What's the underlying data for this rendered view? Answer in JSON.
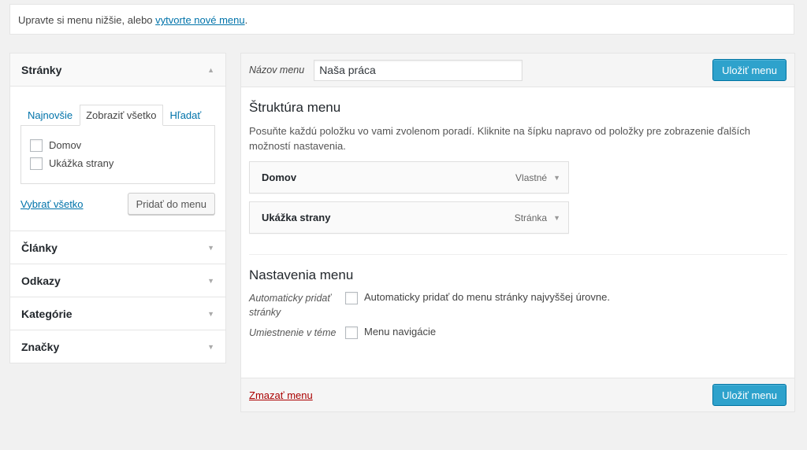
{
  "notice": {
    "text": "Upravte si menu nižšie, alebo ",
    "link": "vytvorte nové menu",
    "suffix": "."
  },
  "accordion": {
    "sections": [
      {
        "title": "Stránky",
        "open": true
      },
      {
        "title": "Články"
      },
      {
        "title": "Odkazy"
      },
      {
        "title": "Kategórie"
      },
      {
        "title": "Značky"
      }
    ],
    "tabs": [
      "Najnovšie",
      "Zobraziť všetko",
      "Hľadať"
    ],
    "active_tab": "Zobraziť všetko",
    "pages": [
      "Domov",
      "Ukážka strany"
    ],
    "select_all": "Vybrať všetko",
    "add_button": "Pridať do menu"
  },
  "menu": {
    "name_label": "Názov menu",
    "name_value": "Naša práca",
    "save_button": "Uložiť menu",
    "structure_title": "Štruktúra menu",
    "structure_desc": "Posuňte každú položku vo vami zvolenom poradí. Kliknite na šípku napravo od položky pre zobrazenie ďalších možností nastavenia.",
    "items": [
      {
        "title": "Domov",
        "type": "Vlastné"
      },
      {
        "title": "Ukážka strany",
        "type": "Stránka"
      }
    ],
    "settings_title": "Nastavenia menu",
    "auto_add_label": "Automaticky pridať stránky",
    "auto_add_text": "Automaticky pridať do menu stránky najvyššej úrovne.",
    "location_label": "Umiestnenie v téme",
    "location_text": "Menu navigácie",
    "delete_link": "Zmazať menu"
  },
  "colors": {
    "primary_button": "#2ea2cc",
    "link": "#0073aa",
    "delete": "#aa0000"
  }
}
